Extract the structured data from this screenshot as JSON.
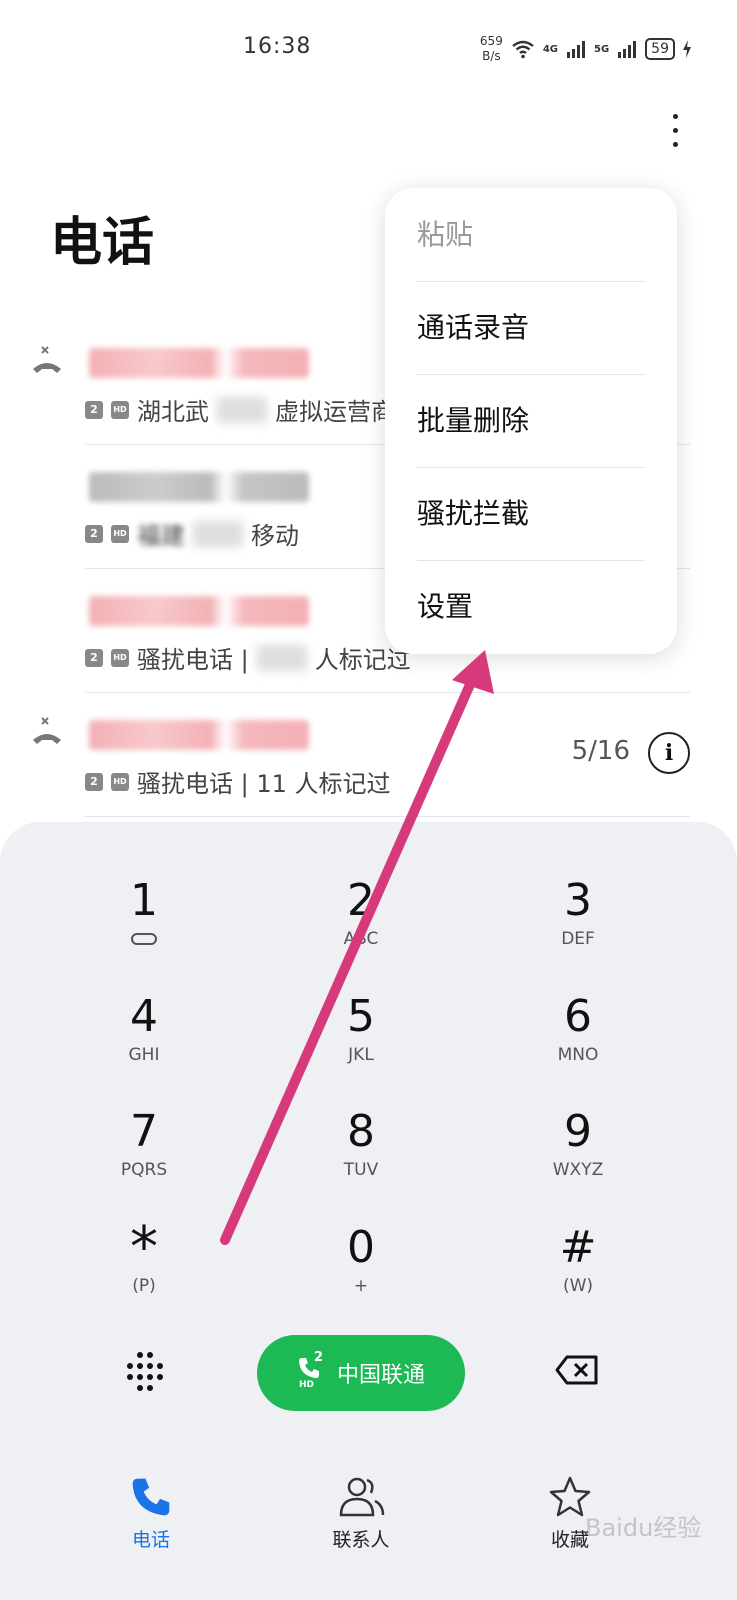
{
  "status_bar": {
    "time": "16:38",
    "net_speed_value": "659",
    "net_speed_unit": "B/s",
    "signal1": "4G",
    "signal2": "5G",
    "battery": "59"
  },
  "page": {
    "title": "电话"
  },
  "calls": [
    {
      "location": "湖北武",
      "carrier": "虚拟运营商",
      "sim": "2",
      "hd": "HD"
    },
    {
      "location": "福建",
      "carrier": "移动",
      "sim": "2",
      "hd": "HD"
    },
    {
      "location": "骚扰电话 |",
      "carrier": "人标记过",
      "sim": "2",
      "hd": "HD"
    },
    {
      "location": "骚扰电话 | 11 人标记过",
      "carrier": "",
      "sim": "2",
      "hd": "HD",
      "date": "5/16"
    }
  ],
  "menu": {
    "paste": "粘贴",
    "call_recording": "通话录音",
    "batch_delete": "批量删除",
    "harassment_block": "骚扰拦截",
    "settings": "设置"
  },
  "dialpad": {
    "keys": [
      {
        "digit": "1",
        "letters": ""
      },
      {
        "digit": "2",
        "letters": "ABC"
      },
      {
        "digit": "3",
        "letters": "DEF"
      },
      {
        "digit": "4",
        "letters": "GHI"
      },
      {
        "digit": "5",
        "letters": "JKL"
      },
      {
        "digit": "6",
        "letters": "MNO"
      },
      {
        "digit": "7",
        "letters": "PQRS"
      },
      {
        "digit": "8",
        "letters": "TUV"
      },
      {
        "digit": "9",
        "letters": "WXYZ"
      },
      {
        "digit": "*",
        "letters": "(P)"
      },
      {
        "digit": "0",
        "letters": "+"
      },
      {
        "digit": "#",
        "letters": "(W)"
      }
    ],
    "call_label": "中国联通",
    "call_sim": "2",
    "call_hd": "HD"
  },
  "tabs": {
    "phone": "电话",
    "contacts": "联系人",
    "favorites": "收藏"
  },
  "colors": {
    "call_green": "#1db954",
    "active_tab": "#1a73e8",
    "annotation_arrow": "#d63a7a"
  },
  "watermark": "Baidu经验"
}
